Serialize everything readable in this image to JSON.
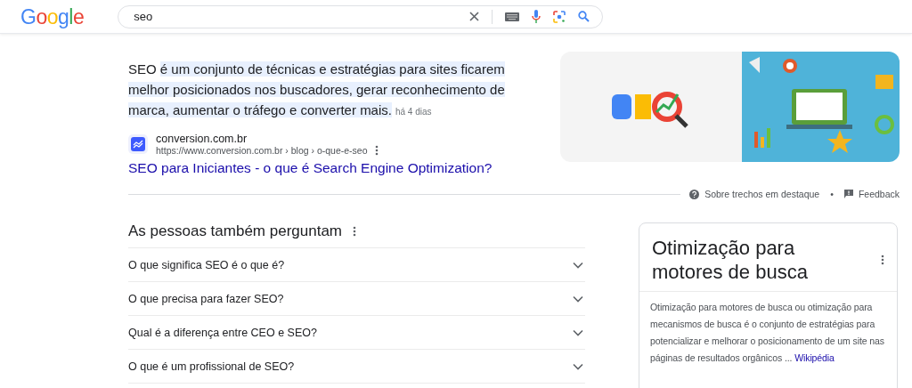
{
  "header": {
    "logo": "Google",
    "search": {
      "value": "seo"
    }
  },
  "featured_snippet": {
    "lead": "SEO",
    "highlighted": "é um conjunto de técnicas e estratégias para sites ficarem melhor posicionados nos buscadores, gerar reconhecimento de marca, aumentar o tráfego e converter mais.",
    "date": "há 4 dias",
    "source": {
      "site": "conversion.com.br",
      "url": "https://www.conversion.com.br › blog › o-que-e-seo",
      "title": "SEO para Iniciantes - o que é Search Engine Optimization?"
    }
  },
  "snippet_footer": {
    "about": "Sobre trechos em destaque",
    "separator": "•",
    "feedback": "Feedback"
  },
  "people_also_ask": {
    "heading": "As pessoas também perguntam",
    "questions": [
      {
        "text": "O que significa SEO é o que é?"
      },
      {
        "text": "O que precisa para fazer SEO?"
      },
      {
        "text": "Qual é a diferença entre CEO e SEO?"
      },
      {
        "text": "O que é um profissional de SEO?"
      }
    ]
  },
  "knowledge_panel": {
    "title": "Otimização para motores de busca",
    "description": "Otimização para motores de busca ou otimização para mecanismos de busca é o conjunto de estratégias para potencializar e melhorar o posicionamento de um site nas páginas de resultados orgânicos ...",
    "source_link": "Wikipédia"
  }
}
